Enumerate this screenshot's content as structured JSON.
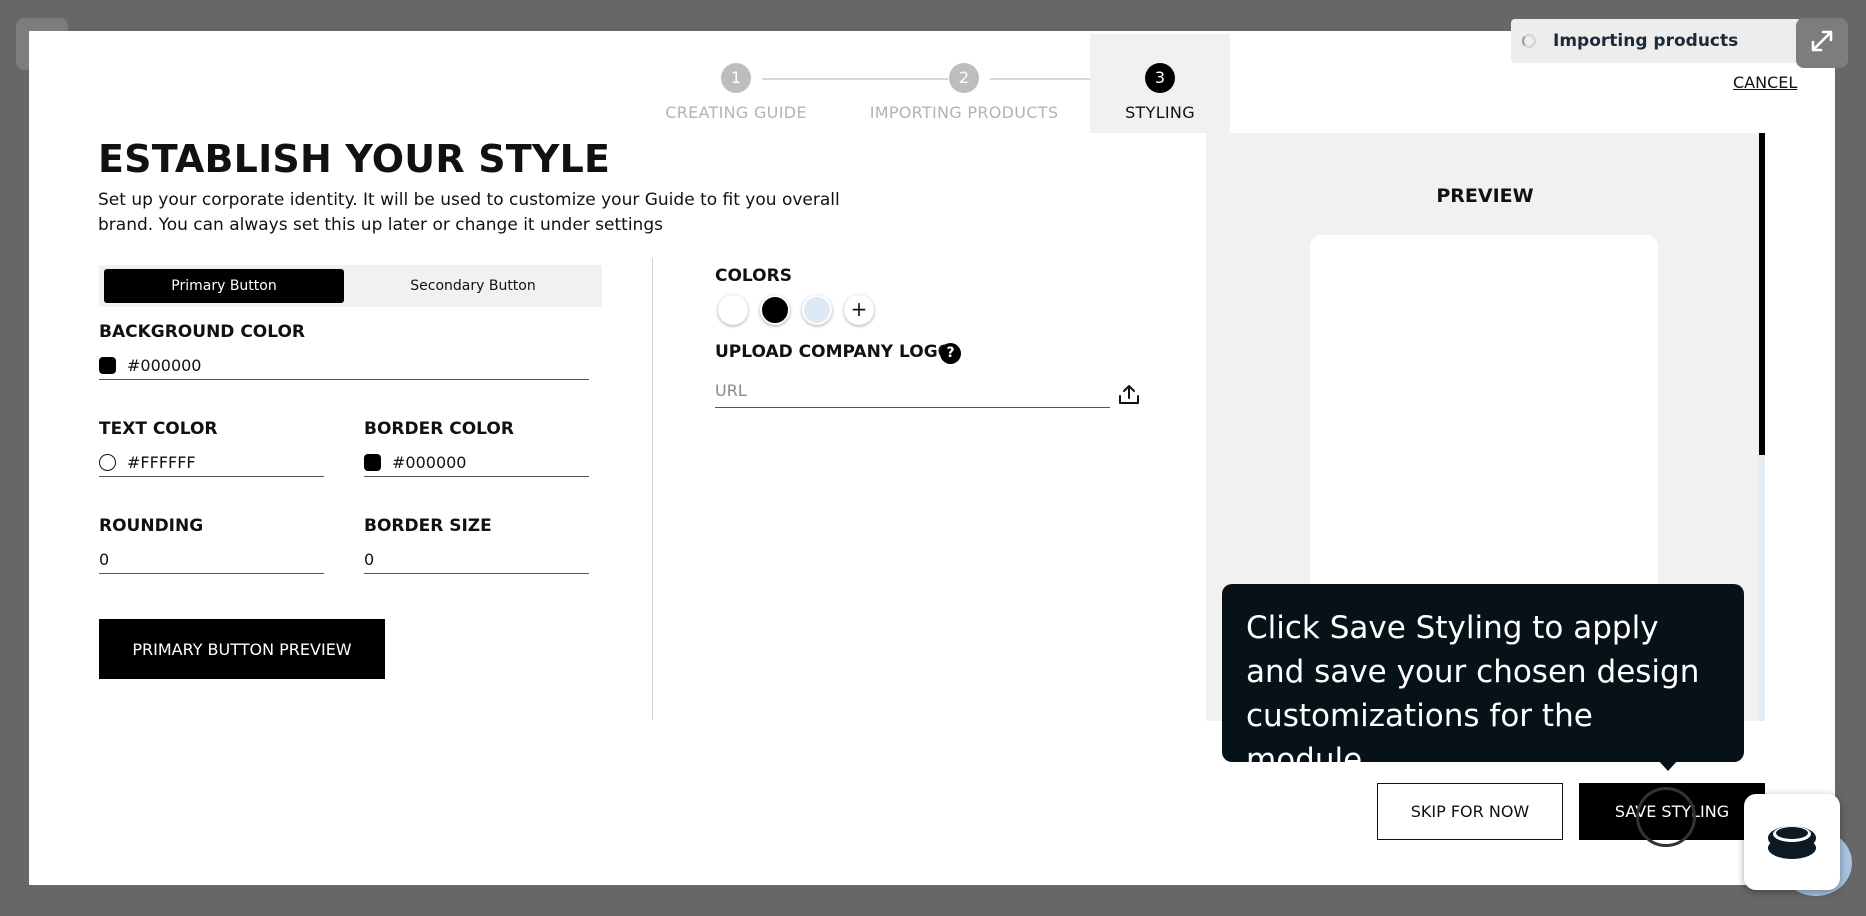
{
  "toast": {
    "text": "Importing products"
  },
  "cancel_label": "CANCEL",
  "steps": [
    {
      "number": "1",
      "label": "CREATING GUIDE",
      "state": "done"
    },
    {
      "number": "2",
      "label": "IMPORTING PRODUCTS",
      "state": "done"
    },
    {
      "number": "3",
      "label": "STYLING",
      "state": "active"
    }
  ],
  "title": "ESTABLISH YOUR STYLE",
  "description": "Set up your corporate identity. It will be used to customize your Guide to fit you overall brand. You can always set this up later or change it under settings",
  "toggle": {
    "primary": "Primary Button",
    "secondary": "Secondary Button",
    "selected": "primary"
  },
  "fields": {
    "background_color": {
      "label": "BACKGROUND COLOR",
      "value": "#000000"
    },
    "text_color": {
      "label": "TEXT COLOR",
      "value": "#FFFFFF"
    },
    "border_color": {
      "label": "BORDER COLOR",
      "value": "#000000"
    },
    "rounding": {
      "label": "ROUNDING",
      "value": "0"
    },
    "border_size": {
      "label": "BORDER SIZE",
      "value": "0"
    }
  },
  "preview_button": "PRIMARY BUTTON PREVIEW",
  "colors": {
    "label": "COLORS",
    "swatches": [
      "#ffffff",
      "#000000",
      "#dde9f5"
    ],
    "add_symbol": "+"
  },
  "logo": {
    "label": "UPLOAD COMPANY LOGO",
    "help_symbol": "?",
    "placeholder": "URL"
  },
  "preview": {
    "title": "PREVIEW"
  },
  "tooltip": "Click Save Styling to apply and save your chosen design customizations for the module.",
  "actions": {
    "skip": "SKIP FOR NOW",
    "save": "SAVE STYLING"
  }
}
